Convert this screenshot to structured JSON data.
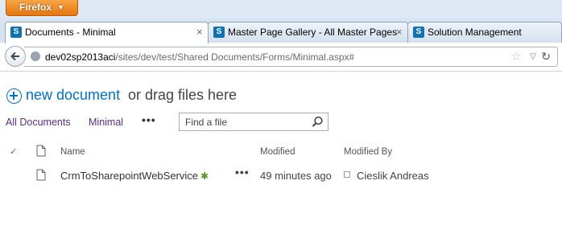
{
  "browser": {
    "app_button": "Firefox",
    "tabs": [
      {
        "title": "Documents - Minimal",
        "favicon": "S",
        "active": true,
        "close": "×"
      },
      {
        "title": "Master Page Gallery - All Master Pages",
        "favicon": "S",
        "active": false,
        "close": "×"
      },
      {
        "title": "Solution Management",
        "favicon": "S",
        "active": false
      }
    ],
    "url": {
      "host": "dev02sp2013aci",
      "path": "/sites/dev/test/Shared Documents/Forms/Minimal.aspx#"
    }
  },
  "page": {
    "new_document": "new document",
    "drag_text": "or drag files here",
    "views": [
      "All Documents",
      "Minimal"
    ],
    "view_more": "•••",
    "search": {
      "placeholder": "Find a file"
    },
    "columns": {
      "check": "✓",
      "name": "Name",
      "modified": "Modified",
      "modified_by": "Modified By"
    },
    "rows": [
      {
        "name": "CrmToSharepointWebService",
        "new_marker": "✱",
        "more": "•••",
        "modified": "49 minutes ago",
        "modified_by": "Cieslik Andreas"
      }
    ]
  },
  "colors": {
    "link_blue": "#0072c6",
    "view_purple": "#5b2c8f",
    "firefox_orange": "#e6760f",
    "new_green": "#4f9c1e"
  }
}
